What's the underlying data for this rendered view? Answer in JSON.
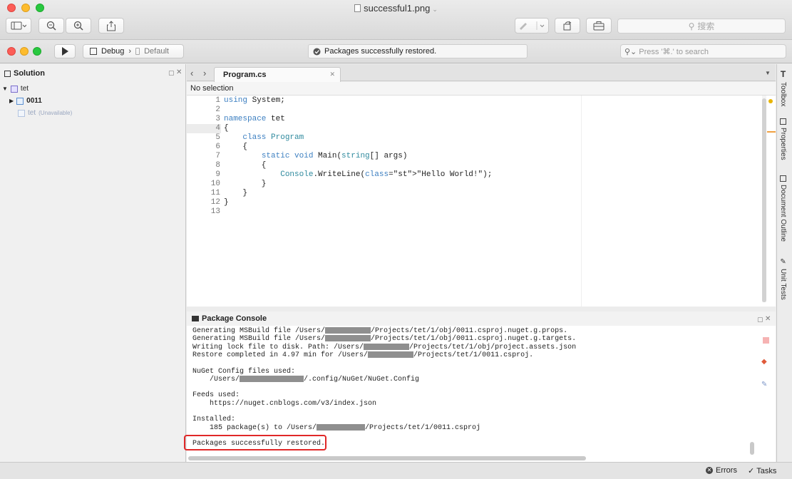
{
  "window": {
    "title": "successful1.png"
  },
  "toolbar": {
    "search_placeholder": "搜索"
  },
  "runbar": {
    "config": "Debug",
    "target": "Default",
    "status": "Packages successfully restored.",
    "search_placeholder": "Press '⌘.' to search"
  },
  "solution": {
    "title": "Solution",
    "items": [
      {
        "label": "tet",
        "note": ""
      },
      {
        "label": "0011",
        "note": ""
      },
      {
        "label": "tet",
        "note": "(Unavailable)"
      }
    ]
  },
  "editor": {
    "tab": "Program.cs",
    "selection": "No selection",
    "lines": [
      {
        "n": "1",
        "text": "using System;"
      },
      {
        "n": "2",
        "text": ""
      },
      {
        "n": "3",
        "text": "namespace tet"
      },
      {
        "n": "4",
        "text": "{"
      },
      {
        "n": "5",
        "text": "    class Program"
      },
      {
        "n": "6",
        "text": "    {"
      },
      {
        "n": "7",
        "text": "        static void Main(string[] args)"
      },
      {
        "n": "8",
        "text": "        {"
      },
      {
        "n": "9",
        "text": "            Console.WriteLine(\"Hello World!\");"
      },
      {
        "n": "10",
        "text": "        }"
      },
      {
        "n": "11",
        "text": "    }"
      },
      {
        "n": "12",
        "text": "}"
      },
      {
        "n": "13",
        "text": ""
      }
    ]
  },
  "console": {
    "title": "Package Console",
    "lines": [
      {
        "a": "Generating MSBuild file /Users/",
        "b": "/Projects/tet/1/obj/0011.csproj.nuget.g.props."
      },
      {
        "a": "Generating MSBuild file /Users/",
        "b": "/Projects/tet/1/obj/0011.csproj.nuget.g.targets."
      },
      {
        "a": "Writing lock file to disk. Path: /Users/",
        "b": "/Projects/tet/1/obj/project.assets.json"
      },
      {
        "a": "Restore completed in 4.97 min for /Users/",
        "b": "/Projects/tet/1/0011.csproj."
      },
      {
        "a": "",
        "b": ""
      },
      {
        "a": "NuGet Config files used:",
        "b": ""
      },
      {
        "a": "    /Users/",
        "b": "/.config/NuGet/NuGet.Config"
      },
      {
        "a": "",
        "b": ""
      },
      {
        "a": "Feeds used:",
        "b": ""
      },
      {
        "a": "    https://nuget.cnblogs.com/v3/index.json",
        "b": ""
      },
      {
        "a": "",
        "b": ""
      },
      {
        "a": "Installed:",
        "b": ""
      },
      {
        "a": "    185 package(s) to /Users/",
        "b": "/Projects/tet/1/0011.csproj"
      },
      {
        "a": "",
        "b": ""
      },
      {
        "a": "Packages successfully restored.",
        "b": ""
      }
    ]
  },
  "right_tabs": [
    "Toolbox",
    "Properties",
    "Document Outline",
    "Unit Tests"
  ],
  "statusbar": {
    "errors": "Errors",
    "tasks": "Tasks"
  }
}
